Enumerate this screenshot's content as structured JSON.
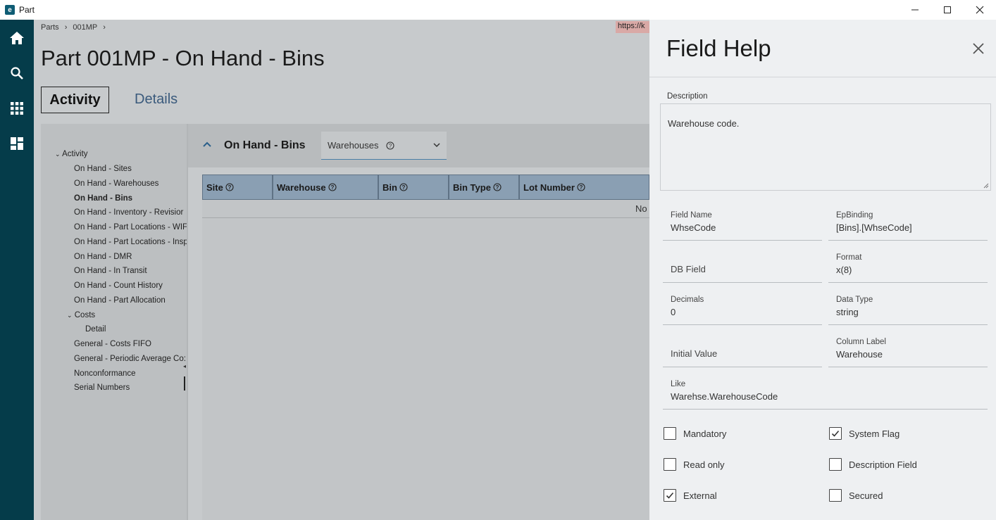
{
  "window": {
    "title": "Part",
    "logo_letter": "e"
  },
  "breadcrumb": [
    "Parts",
    "001MP"
  ],
  "url_fragment": "https://k",
  "page_title": "Part 001MP - On Hand - Bins",
  "tabs": {
    "activity": "Activity",
    "details": "Details"
  },
  "tree": {
    "root": "Activity",
    "items": [
      "On Hand - Sites",
      "On Hand - Warehouses",
      "On Hand - Bins",
      "On Hand - Inventory - Revisior",
      "On Hand - Part Locations - WIF",
      "On Hand - Part Locations - Insp",
      "On Hand - DMR",
      "On Hand - In Transit",
      "On Hand - Count History",
      "On Hand - Part Allocation"
    ],
    "costs": "Costs",
    "costs_detail": "Detail",
    "tail": [
      "General - Costs FIFO",
      "General - Periodic Average Co:",
      "Nonconformance",
      "Serial Numbers"
    ]
  },
  "panel": {
    "title": "On Hand - Bins",
    "dropdown_value": "Warehouses",
    "columns": [
      "Site",
      "Warehouse",
      "Bin",
      "Bin Type",
      "Lot Number"
    ],
    "empty_text": "No"
  },
  "help": {
    "title": "Field Help",
    "description_label": "Description",
    "description": "Warehouse code.",
    "fields": {
      "field_name": {
        "label": "Field Name",
        "value": "WhseCode"
      },
      "ep_binding": {
        "label": "EpBinding",
        "value": "[Bins].[WhseCode]"
      },
      "db_field": {
        "label": "DB Field",
        "value": ""
      },
      "format": {
        "label": "Format",
        "value": "x(8)"
      },
      "decimals": {
        "label": "Decimals",
        "value": "0"
      },
      "data_type": {
        "label": "Data Type",
        "value": "string"
      },
      "initial_value": {
        "label": "Initial Value",
        "value": ""
      },
      "column_label": {
        "label": "Column Label",
        "value": "Warehouse"
      },
      "like": {
        "label": "Like",
        "value": "Warehse.WarehouseCode"
      }
    },
    "checkboxes": {
      "mandatory": {
        "label": "Mandatory",
        "checked": false
      },
      "system_flag": {
        "label": "System Flag",
        "checked": true
      },
      "read_only": {
        "label": "Read only",
        "checked": false
      },
      "description_field": {
        "label": "Description Field",
        "checked": false
      },
      "external": {
        "label": "External",
        "checked": true
      },
      "secured": {
        "label": "Secured",
        "checked": false
      }
    }
  },
  "colors": {
    "rail": "#053c4a",
    "accent": "#4a7fa8",
    "grid_header": "#8a9fb3"
  }
}
